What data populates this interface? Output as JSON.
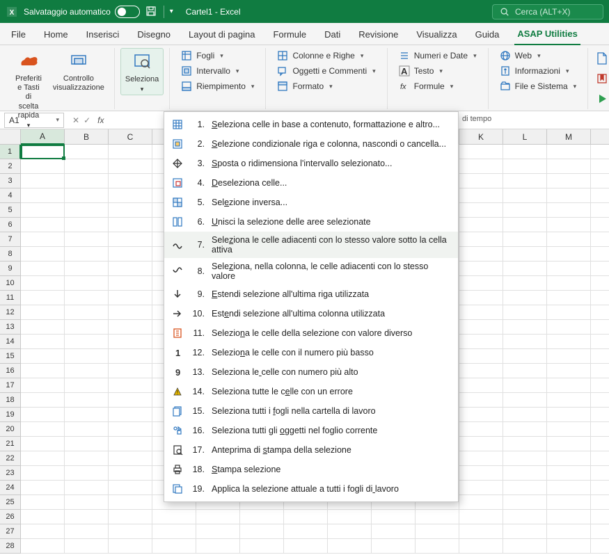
{
  "titlebar": {
    "autosave_label": "Salvataggio automatico",
    "doc_name": "Cartel1",
    "app_name": "Excel",
    "search_placeholder": "Cerca (ALT+X)"
  },
  "tabs": [
    "File",
    "Home",
    "Inserisci",
    "Disegno",
    "Layout di pagina",
    "Formule",
    "Dati",
    "Revisione",
    "Visualizza",
    "Guida",
    "ASAP Utilities"
  ],
  "active_tab_index": 10,
  "ribbon": {
    "preferiti": {
      "big1": "Preferiti e Tasti di\nscelta rapida",
      "big2": "Controllo\nvisualizzazione",
      "label": "Preferiti"
    },
    "seleziona_big": "Seleziona",
    "cols": {
      "c1": [
        "Fogli",
        "Intervallo",
        "Riempimento"
      ],
      "c2": [
        "Colonne e Righe",
        "Oggetti e Commenti",
        "Formato"
      ],
      "c3": [
        "Numeri e Date",
        "Testo",
        "Formule"
      ],
      "c4": [
        "Web",
        "Informazioni",
        "File e Sistema"
      ]
    }
  },
  "behind_label": "di tempo",
  "namebox": "A1",
  "columns": [
    "A",
    "B",
    "C",
    "",
    "",
    "",
    "",
    "",
    "",
    "",
    "K",
    "L",
    "M",
    ""
  ],
  "row_count": 28,
  "menu": [
    {
      "n": "1.",
      "t": "Seleziona celle in base a contenuto, formattazione e altro...",
      "u": 0
    },
    {
      "n": "2.",
      "t": "Selezione condizionale riga e colonna, nascondi o cancella...",
      "u": 0
    },
    {
      "n": "3.",
      "t": "Sposta o ridimensiona l'intervallo selezionato...",
      "u": 0
    },
    {
      "n": "4.",
      "t": "Deseleziona celle...",
      "u": 0
    },
    {
      "n": "5.",
      "t": "Selezione inversa...",
      "u": 3
    },
    {
      "n": "6.",
      "t": "Unisci la selezione delle aree selezionate",
      "u": 0
    },
    {
      "n": "7.",
      "t": "Seleziona le celle adiacenti con lo stesso valore sotto la cella attiva",
      "u": 4,
      "hover": true
    },
    {
      "n": "8.",
      "t": "Seleziona, nella colonna, le celle adiacenti con lo stesso valore",
      "u": 4
    },
    {
      "n": "9.",
      "t": "Estendi selezione all'ultima riga utilizzata",
      "u": 0
    },
    {
      "n": "10.",
      "t": "Estendi selezione all'ultima colonna utilizzata",
      "u": 3
    },
    {
      "n": "11.",
      "t": "Seleziona le celle della selezione con valore diverso",
      "u": 7
    },
    {
      "n": "12.",
      "t": "Seleziona le celle con il numero più basso",
      "u": 7
    },
    {
      "n": "13.",
      "t": "Seleziona le celle con numero più alto",
      "u": 12
    },
    {
      "n": "14.",
      "t": "Seleziona tutte le celle con un errore",
      "u": 20
    },
    {
      "n": "15.",
      "t": "Seleziona tutti i fogli nella cartella di lavoro",
      "u": 18
    },
    {
      "n": "16.",
      "t": "Seleziona tutti gli oggetti nel foglio corrente",
      "u": 20
    },
    {
      "n": "17.",
      "t": "Anteprima di stampa della selezione",
      "u": 13
    },
    {
      "n": "18.",
      "t": "Stampa selezione",
      "u": 0
    },
    {
      "n": "19.",
      "t": "Applica la selezione attuale a tutti i fogli di lavoro",
      "u": 47
    }
  ],
  "menu_icons": [
    "grid",
    "gridc",
    "arrows",
    "desel",
    "inv",
    "merge",
    "wave",
    "wave2",
    "down",
    "right",
    "diff",
    "one",
    "nine",
    "tri",
    "sheets",
    "objs",
    "preview",
    "print",
    "apply"
  ]
}
